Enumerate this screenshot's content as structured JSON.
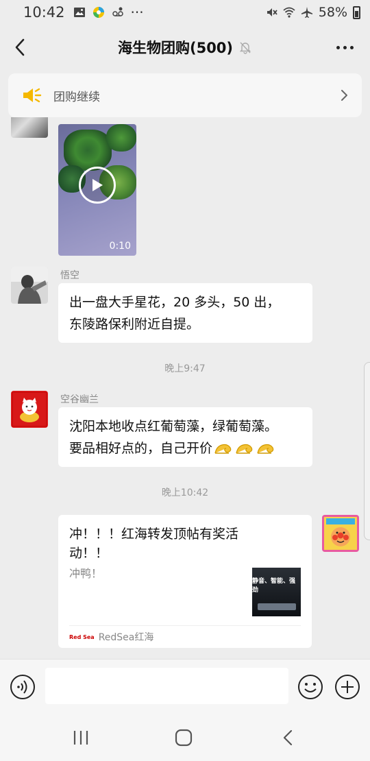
{
  "status_bar": {
    "time": "10:42",
    "battery": "58%",
    "more": "···",
    "icons_left": [
      "image-icon",
      "app-icon",
      "voicemail-icon"
    ],
    "icons_right": [
      "mute-icon",
      "wifi-icon",
      "airplane-icon",
      "battery-icon"
    ]
  },
  "header": {
    "title": "海生物团购(500)",
    "muted": true
  },
  "notice": {
    "text": "团购继续"
  },
  "messages": [
    {
      "type": "video",
      "duration": "0:10"
    },
    {
      "type": "text",
      "sender": "悟空",
      "lines": [
        "出一盘大手星花，20 多头，50 出，",
        "东陵路保利附近自提。"
      ]
    },
    {
      "type": "time",
      "text": "晚上9:47"
    },
    {
      "type": "text",
      "sender": "空谷幽兰",
      "lines": [
        "沈阳本地收点红葡萄藻，绿葡萄藻。",
        "要品相好点的，自己开价"
      ],
      "emoji_count": 3
    },
    {
      "type": "time",
      "text": "晚上10:42"
    },
    {
      "type": "link",
      "title": "冲！！！红海转发顶帖有奖活动！！",
      "description": "冲鸭！",
      "thumb_text": "静音、智能、强劲",
      "source_logo": "Red Sea",
      "source": "RedSea红海"
    }
  ],
  "input": {
    "value": "",
    "placeholder": ""
  },
  "colors": {
    "background": "#ededed",
    "bubble": "#ffffff",
    "notice_icon": "#f5b800"
  }
}
